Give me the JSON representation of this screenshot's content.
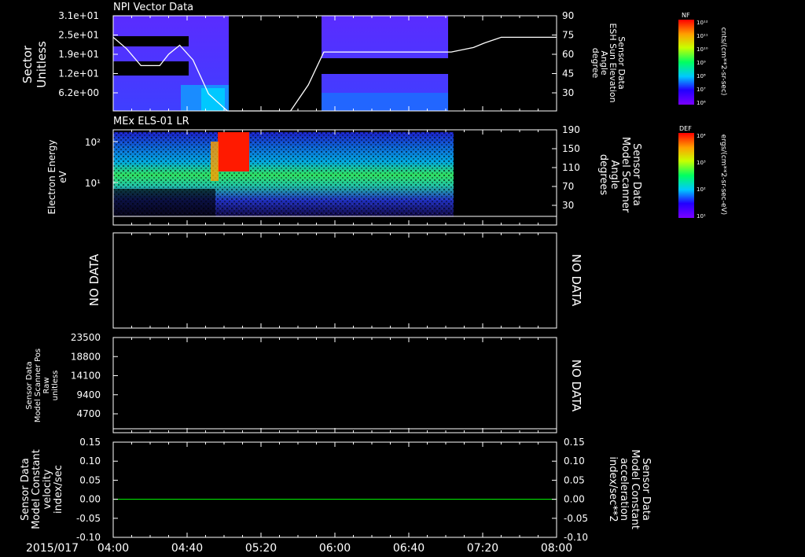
{
  "chart_data": [
    {
      "type": "heatmap",
      "title": "NPI Vector Data",
      "ylabel": "Sector\nUnitless",
      "yticks": [
        "3.1e+01",
        "2.5e+01",
        "1.9e+01",
        "1.2e+01",
        "6.2e+00"
      ],
      "right_ylabel": [
        "Sensor Data",
        "ESH Sun Elevation",
        "Angle",
        "degree"
      ],
      "right_yticks": [
        "90",
        "75",
        "60",
        "45",
        "30"
      ],
      "right_ylim": [
        15,
        90
      ],
      "colorbar_label": "NF",
      "colorbar_units": "cnts/(cm**2-sr-sec)",
      "colorbar_ticks": [
        "10¹²",
        "10¹¹",
        "10¹⁰",
        "10⁹",
        "10⁸",
        "10⁷",
        "10⁶"
      ],
      "data_coverage_hours": [
        [
          4.0,
          4.98
        ],
        [
          5.75,
          6.92
        ]
      ],
      "elevation_line": {
        "x": [
          4.0,
          4.12,
          4.25,
          4.42,
          4.5,
          4.6,
          4.72,
          4.86,
          5.03,
          5.6,
          5.76,
          5.9,
          6.1,
          7.05,
          7.25,
          7.35,
          7.5,
          8.0
        ],
        "y": [
          80,
          70,
          55,
          55,
          65,
          73,
          60,
          30,
          15,
          15,
          38,
          67,
          67,
          67,
          71,
          75,
          80,
          80
        ]
      }
    },
    {
      "type": "heatmap",
      "title": "MEx ELS-01 LR",
      "ylabel": "Electron Energy\neV",
      "yticks": [
        "10²",
        "10¹"
      ],
      "right_ylabel": [
        "Sensor Data",
        "Model Scanner",
        "Angle",
        "degrees"
      ],
      "right_yticks": [
        "190",
        "150",
        "110",
        "70",
        "30"
      ],
      "colorbar_label": "DEF",
      "colorbar_units": "ergs/(cm**2-sr-sec-eV)",
      "colorbar_ticks": [
        "10⁴",
        "10³",
        "10²",
        "10¹"
      ],
      "data_coverage_hours": [
        [
          4.0,
          6.92
        ]
      ],
      "high_flux_hours": [
        4.94,
        5.12
      ],
      "scanner_line_value": 15
    },
    {
      "type": "line",
      "ylabel": "NO DATA",
      "right_label": "NO DATA"
    },
    {
      "type": "line",
      "ylabel": [
        "Sensor Data",
        "Model Scanner Pos",
        "Raw",
        "unitless"
      ],
      "yticks": [
        "23500",
        "18800",
        "14100",
        "9400",
        "4700"
      ],
      "ylim": [
        0,
        23500
      ],
      "right_label": "NO DATA",
      "line_value": 0
    },
    {
      "type": "line",
      "ylabel": [
        "Sensor Data",
        "Model Constant",
        "velocity",
        "index/sec"
      ],
      "yticks": [
        "0.15",
        "0.10",
        "0.05",
        "0.00",
        "-0.05",
        "-0.10"
      ],
      "right_yticks": [
        "0.15",
        "0.10",
        "0.05",
        "0.00",
        "-0.05",
        "-0.10"
      ],
      "ylim": [
        -0.1,
        0.15
      ],
      "right_ylabel": [
        "Sensor Data",
        "Model Constant",
        "acceleration",
        "index/sec**2"
      ],
      "right_color": "#00ff00",
      "series": [
        {
          "name": "acceleration",
          "x": [
            4.0,
            8.0
          ],
          "values": [
            0.0,
            0.0
          ],
          "color": "#00ff00"
        }
      ]
    }
  ],
  "x_axis": {
    "date": "2015/017",
    "ticks": [
      "04:00",
      "04:40",
      "05:20",
      "06:00",
      "06:40",
      "07:20",
      "08:00"
    ],
    "range_hours": [
      4.0,
      8.0
    ]
  }
}
